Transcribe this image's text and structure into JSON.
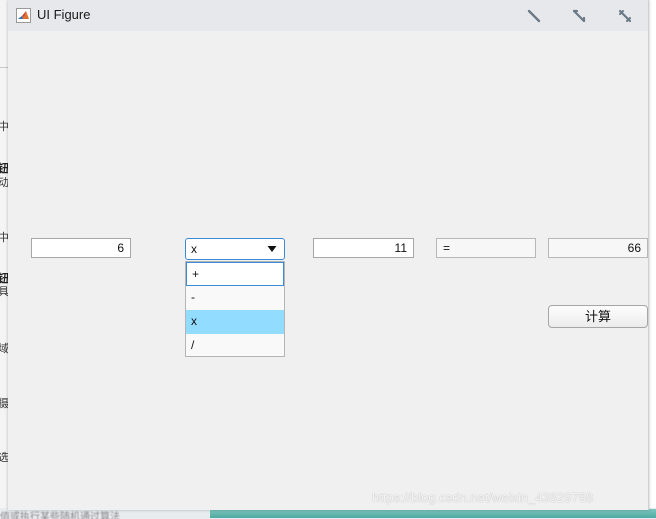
{
  "window": {
    "title": "UI Figure",
    "icons": [
      "matlab-icon",
      "undock-icon",
      "dock-icon",
      "collapse-icon"
    ]
  },
  "fields": {
    "operand1": "6",
    "operand2": "11",
    "equals": "=",
    "result": "66"
  },
  "operator": {
    "selected": "x",
    "options": [
      "+",
      "-",
      "x",
      "/"
    ],
    "selected_index": 2
  },
  "buttons": {
    "calculate": "计算"
  },
  "watermark": "https://blog.csdn.net/weixin_43829768",
  "background_app": {
    "fragments": [
      "中",
      "钮",
      "动",
      "中",
      "钮",
      "具",
      "域",
      "摄",
      "选"
    ],
    "bottom_text": "值或执行某些随机通过算法"
  },
  "colors": {
    "accent": "#3c8bd4",
    "selected_item": "#91dcff",
    "figure_bg": "#f0f0f0",
    "titlebar_bg": "#e7e8ec"
  }
}
